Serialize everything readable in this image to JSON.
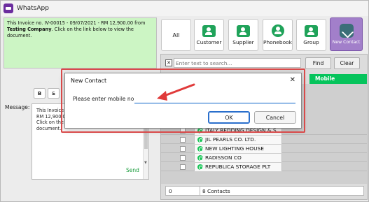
{
  "window": {
    "title": "WhatsApp"
  },
  "preview": {
    "line1": "This Invoice no. IV-00015 - 09/07/2021 - RM 12,900.00 from",
    "company": "Testing Company",
    "line2": ". Click on the link below to view the document."
  },
  "formatting": {
    "bold": "B",
    "strike": "S"
  },
  "message": {
    "label": "Message:",
    "lines": [
      "This Invoice",
      "RM 12,900.0",
      "Click on the li",
      "document."
    ],
    "send": "Send"
  },
  "categories": [
    {
      "label": "All",
      "icon": "",
      "selected": false
    },
    {
      "label": "Customer",
      "icon": "customer-icon",
      "selected": false
    },
    {
      "label": "Supplier",
      "icon": "supplier-icon",
      "selected": false
    },
    {
      "label": "Phonebook",
      "icon": "phonebook-icon",
      "selected": false
    },
    {
      "label": "Group",
      "icon": "group-icon",
      "selected": false
    },
    {
      "label": "New Contact",
      "icon": "new-contact-phone-icon",
      "selected": true
    }
  ],
  "search": {
    "clear": "✕",
    "placeholder": "Enter text to search...",
    "find": "Find",
    "clear_button": "Clear"
  },
  "grid": {
    "header_mobile": "Mobile",
    "rows": [
      "ITALY BEDDING DESIGN & S",
      "JIL PEARLS CO. LTD.",
      "NEW LIGHTING HOUSE",
      "RADISSON CO",
      "REPUBLICA STORAGE PLT"
    ]
  },
  "footer": {
    "count_left": "0",
    "count_label": "8 Contacts"
  },
  "dialog": {
    "title": "New Contact",
    "close": "✕",
    "prompt": "Please enter mobile no.",
    "input_value": "",
    "ok": "OK",
    "cancel": "Cancel"
  },
  "colors": {
    "highlight": "#d94a4a",
    "mobile_header": "#06c45c",
    "selected_category": "#a27fca",
    "preview_bg": "#ccf5c4"
  }
}
